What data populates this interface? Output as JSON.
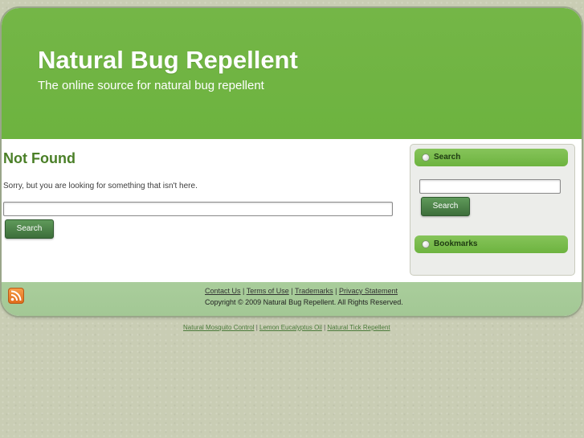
{
  "header": {
    "title": "Natural Bug Repellent",
    "tagline": "The online source for natural bug repellent"
  },
  "content": {
    "heading": "Not Found",
    "message": "Sorry, but you are looking for something that isn't here.",
    "search_value": "",
    "search_button": "Search"
  },
  "sidebar": {
    "search_widget_title": "Search",
    "search_value": "",
    "search_button": "Search",
    "bookmarks_widget_title": "Bookmarks"
  },
  "footer": {
    "rss_icon": "rss-feed-icon",
    "links": [
      "Contact Us",
      "Terms of Use",
      "Trademarks",
      "Privacy Statement"
    ],
    "separator": "|",
    "copyright": "Copyright © 2009 Natural Bug Repellent. All Rights Reserved."
  },
  "below_links": {
    "links": [
      "Natural Mosquito Control",
      "Lemon Eucalyptus Oil",
      "Natural Tick Repellent"
    ],
    "separator": "|"
  },
  "colors": {
    "header_green": "#6db33f",
    "heading_green": "#4a7f27",
    "footer_green": "#a9cd9b",
    "button_green": "#3d6e3a"
  }
}
